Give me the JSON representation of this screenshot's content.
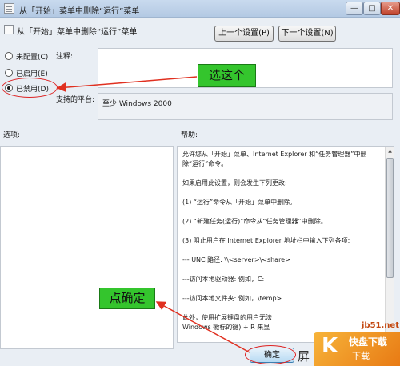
{
  "window": {
    "title": "从「开始」菜单中删除“运行”菜单",
    "minimize": "—",
    "maximize": "□",
    "close": "✕"
  },
  "header": {
    "title": "从「开始」菜单中删除“运行”菜单",
    "prev_label": "上一个设置(P)",
    "next_label": "下一个设置(N)"
  },
  "radios": [
    {
      "label": "未配置(C)",
      "checked": false
    },
    {
      "label": "已启用(E)",
      "checked": false
    },
    {
      "label": "已禁用(D)",
      "checked": true
    }
  ],
  "fields": {
    "comment_label": "注释:",
    "comment_value": "",
    "platform_label": "支持的平台:",
    "platform_value": "至少 Windows 2000"
  },
  "annotations": {
    "callout1": "选这个",
    "callout2": "点确定",
    "color": "#34c52d",
    "arrow_color": "#e03020",
    "oval_color": "#d22222"
  },
  "sections": {
    "options_label": "选项:",
    "help_label": "帮助:"
  },
  "help_text": [
    "允许您从「开始」菜单、Internet Explorer 和“任务管理器”中删除“运行”命令。",
    "如果启用此设置，则会发生下列更改:",
    "(1) “运行”命令从「开始」菜单中删除。",
    "(2) “新建任务(运行)”命令从“任务管理器”中删除。",
    "(3) 阻止用户在 Internet Explorer 地址栏中输入下列各项:",
    "--- UNC 路径: \\\\<server>\\<share>",
    "---访问本地驱动器: 例如，C:",
    "---访问本地文件夹: 例如，\\temp>",
    "此外，使用扩展键盘的用户无法",
    "Windows 徽标的键) + R 来显"
  ],
  "footer": {
    "ok_label": "确定"
  },
  "watermark": {
    "site": "jb51.net",
    "k": "K",
    "line1": "快盘下载",
    "line2": "下载",
    "fragment": "屏"
  }
}
